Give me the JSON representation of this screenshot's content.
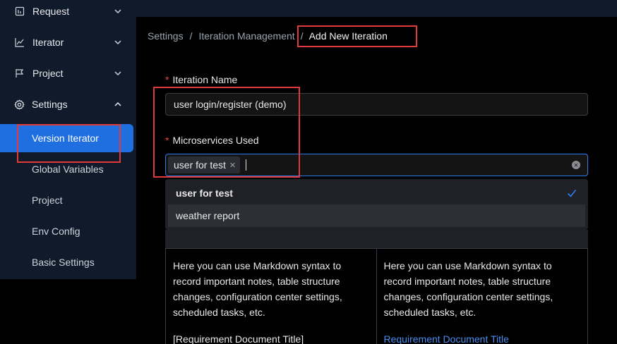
{
  "sidebar": {
    "items": [
      {
        "label": "Request",
        "icon": "request-icon",
        "chevron": "down"
      },
      {
        "label": "Iterator",
        "icon": "chart-line-icon",
        "chevron": "down"
      },
      {
        "label": "Project",
        "icon": "flag-icon",
        "chevron": "down"
      },
      {
        "label": "Settings",
        "icon": "gear-icon",
        "chevron": "up"
      }
    ],
    "sub_items": [
      {
        "label": "Version Iterator",
        "active": true
      },
      {
        "label": "Global Variables"
      },
      {
        "label": "Project"
      },
      {
        "label": "Env Config"
      },
      {
        "label": "Basic Settings"
      }
    ]
  },
  "breadcrumb": {
    "items": [
      "Settings",
      "Iteration Management",
      "Add New Iteration"
    ],
    "separator": "/"
  },
  "form": {
    "iteration_name": {
      "required_mark": "*",
      "label": "Iteration Name",
      "value": "user login/register (demo)"
    },
    "microservices": {
      "required_mark": "*",
      "label": "Microservices Used",
      "selected_tags": [
        "user for test"
      ],
      "options": [
        {
          "label": "user for test",
          "selected": true
        },
        {
          "label": "weather report",
          "selected": false
        }
      ]
    }
  },
  "editor": {
    "source_lines": [
      "Here you can use Markdown syntax to record important notes, table structure changes, configuration center settings, scheduled tasks, etc.",
      "[Requirement Document Title]"
    ],
    "preview_lines": [
      "Here you can use Markdown syntax to record important notes, table structure changes, configuration center settings, scheduled tasks, etc.",
      "Requirement Document Title"
    ]
  },
  "colors": {
    "sidebar_bg": "#0f1a2a",
    "active_item": "#1f6fe0",
    "focus_border": "#2f7bf0",
    "required_mark": "#e8473d",
    "highlight_box": "#e03a3a",
    "link": "#4a8ef0"
  }
}
